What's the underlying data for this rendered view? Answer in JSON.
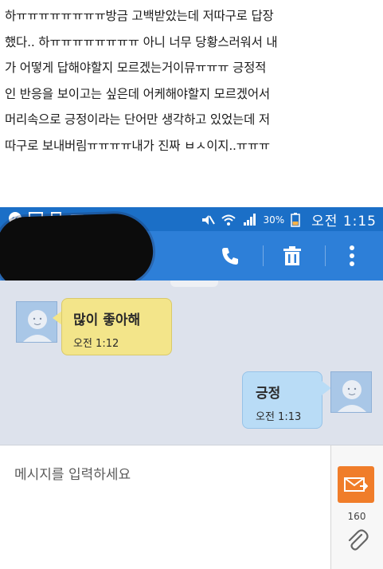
{
  "caption": {
    "lines": [
      "하ㅠㅠㅠㅠㅠㅠㅠㅠ방금 고백받았는데 저따구로 답장",
      "했다.. 하ㅠㅠㅠㅠㅠㅠㅠㅠ 아니 너무 당황스러워서 내",
      "가 어떻게 답해야할지 모르겠는거이뮤ㅠㅠㅠ 긍정적",
      "인 반응을 보이고는 싶은데 어케해야할지 모르겠어서",
      "머리속으로 긍정이라는 단어만 생각하고 있었는데 저",
      "따구로 보내버림ㅠㅠㅠㅠ내가 진짜 ㅂㅅ이지..ㅠㅠㅠ"
    ]
  },
  "status_bar": {
    "battery": "30%",
    "time": "오전 1:15",
    "left_icons": [
      "messenger-icon",
      "image-icon",
      "clipboard-icon",
      "keyboard-icon"
    ],
    "right_icons": [
      "mute-icon",
      "wifi-icon",
      "signal-icon",
      "battery-icon"
    ]
  },
  "action_bar": {
    "color": "#2d7fd8",
    "icons": [
      "phone-icon",
      "trash-icon",
      "overflow-menu-icon"
    ]
  },
  "messages": [
    {
      "direction": "received",
      "text": "많이 좋아해",
      "time": "오전 1:12",
      "color": "#f3e58a"
    },
    {
      "direction": "sent",
      "text": "긍정",
      "time": "오전 1:13",
      "color": "#b9dcf6"
    }
  ],
  "composer": {
    "placeholder": "메시지를 입력하세요",
    "char_count": "160",
    "send_color": "#f07d2a"
  }
}
